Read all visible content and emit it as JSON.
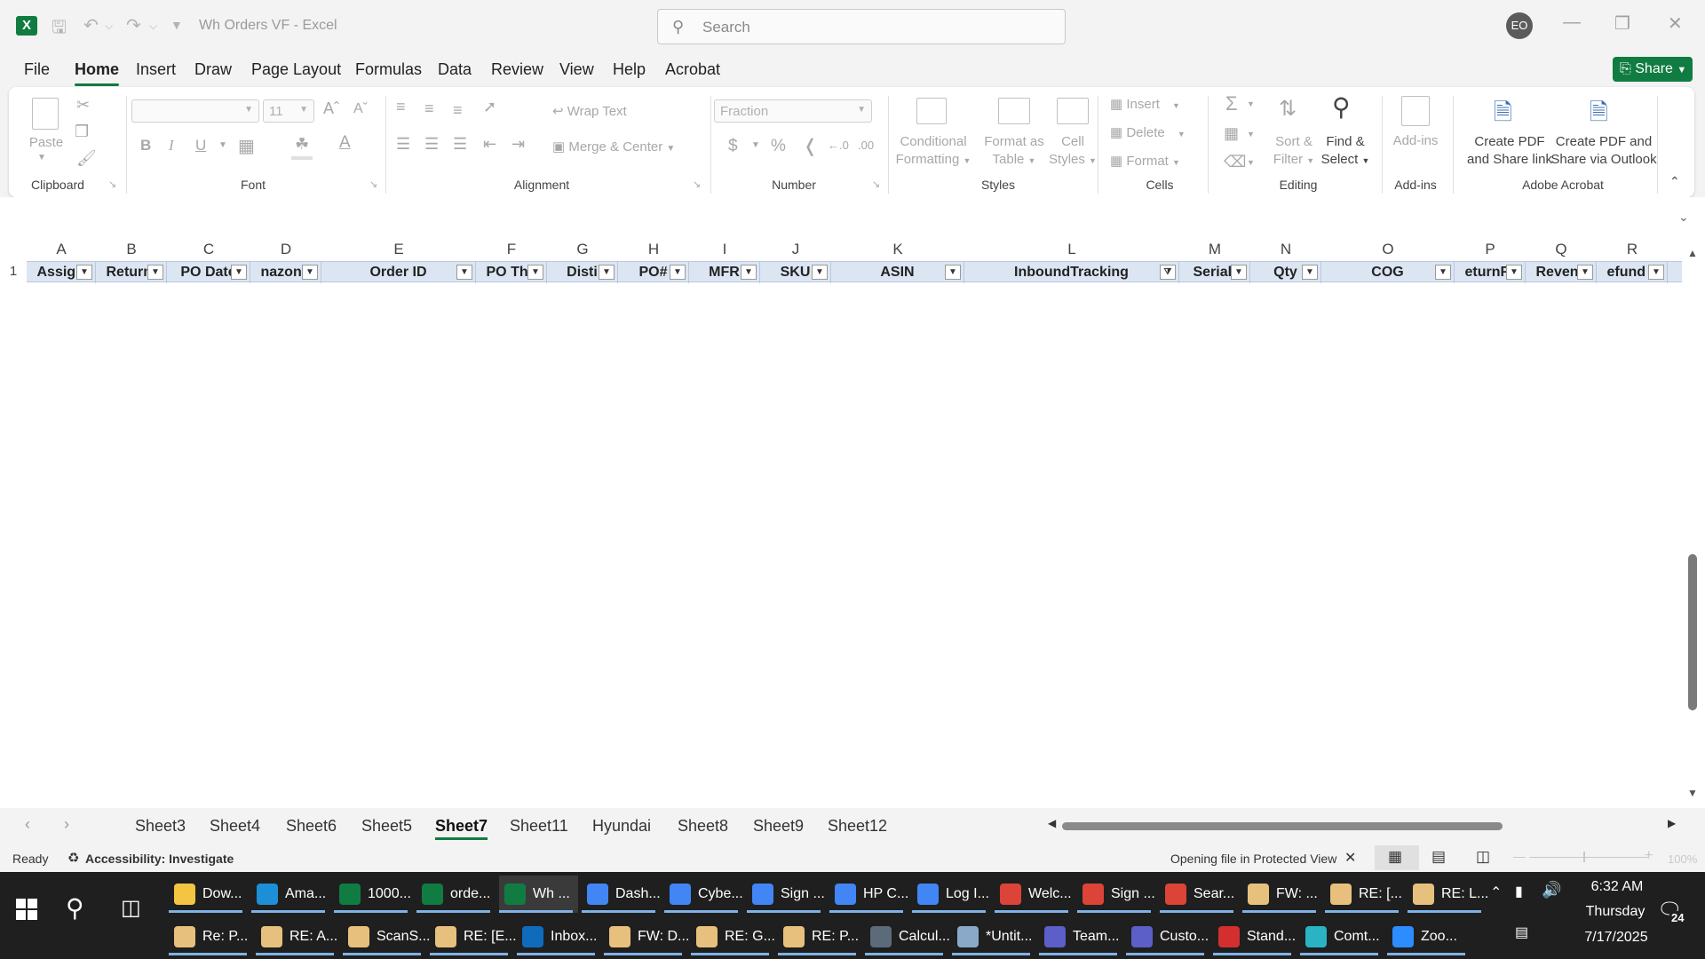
{
  "window": {
    "title": "Wh Orders VF  -  Excel",
    "search_placeholder": "Search",
    "avatar": "EO"
  },
  "menu": [
    "File",
    "Home",
    "Insert",
    "Draw",
    "Page Layout",
    "Formulas",
    "Data",
    "Review",
    "View",
    "Help",
    "Acrobat"
  ],
  "share_label": "Share",
  "ribbon": {
    "clipboard": {
      "label": "Clipboard",
      "paste": "Paste"
    },
    "font": {
      "label": "Font",
      "size": "11",
      "bold": "B",
      "italic": "I",
      "underline": "U"
    },
    "alignment": {
      "label": "Alignment",
      "wrap": "Wrap Text",
      "merge": "Merge & Center"
    },
    "number": {
      "label": "Number",
      "format": "Fraction"
    },
    "styles": {
      "label": "Styles",
      "conditional": [
        "Conditional",
        "Formatting"
      ],
      "format_table": [
        "Format as",
        "Table"
      ],
      "cell_styles": [
        "Cell",
        "Styles"
      ]
    },
    "cells": {
      "label": "Cells",
      "insert": "Insert",
      "delete": "Delete",
      "format": "Format"
    },
    "editing": {
      "label": "Editing",
      "sort": [
        "Sort &",
        "Filter"
      ],
      "find": [
        "Find &",
        "Select"
      ]
    },
    "addins": {
      "label": "Add-ins",
      "addins": "Add-ins"
    },
    "acrobat": {
      "label": "Adobe Acrobat",
      "pdf_link": [
        "Create PDF",
        "and Share link"
      ],
      "pdf_outlook": [
        "Create PDF and",
        "Share via Outlook"
      ]
    }
  },
  "columns": [
    {
      "letter": "A",
      "header": "Assigned"
    },
    {
      "letter": "B",
      "header": "Return D"
    },
    {
      "letter": "C",
      "header": "PO Date"
    },
    {
      "letter": "D",
      "header": "nazon Ac"
    },
    {
      "letter": "E",
      "header": "Order ID"
    },
    {
      "letter": "F",
      "header": "PO Throi"
    },
    {
      "letter": "G",
      "header": "Disti"
    },
    {
      "letter": "H",
      "header": "PO#"
    },
    {
      "letter": "I",
      "header": "MFR"
    },
    {
      "letter": "J",
      "header": "SKU"
    },
    {
      "letter": "K",
      "header": "ASIN"
    },
    {
      "letter": "L",
      "header": "InboundTracking"
    },
    {
      "letter": "M",
      "header": "Seriali"
    },
    {
      "letter": "N",
      "header": "Qty"
    },
    {
      "letter": "O",
      "header": "COG"
    },
    {
      "letter": "P",
      "header": "eturnFre"
    },
    {
      "letter": "Q",
      "header": "Revenu"
    },
    {
      "letter": "R",
      "header": "efund Is"
    }
  ],
  "row_number": "1",
  "sheets": [
    "Sheet3",
    "Sheet4",
    "Sheet6",
    "Sheet5",
    "Sheet7",
    "Sheet11",
    "Hyundai",
    "Sheet8",
    "Sheet9",
    "Sheet12"
  ],
  "active_sheet": "Sheet7",
  "status": {
    "ready": "Ready",
    "accessibility": "Accessibility: Investigate",
    "protected": "Opening file in Protected View",
    "zoom": "100%"
  },
  "taskbar_row1": [
    {
      "label": "Dow...",
      "icon": "folder-icon",
      "color": "#f4c542"
    },
    {
      "label": "Ama...",
      "icon": "edge-icon",
      "color": "#1c8fd6"
    },
    {
      "label": "1000...",
      "icon": "excel-icon",
      "color": "#107c41"
    },
    {
      "label": "orde...",
      "icon": "excel-icon",
      "color": "#107c41"
    },
    {
      "label": "Wh ...",
      "icon": "excel-icon",
      "color": "#107c41"
    },
    {
      "label": "Dash...",
      "icon": "chrome-icon",
      "color": "#4285f4"
    },
    {
      "label": "Cybe...",
      "icon": "chrome-icon",
      "color": "#4285f4"
    },
    {
      "label": "Sign ...",
      "icon": "chrome-icon",
      "color": "#4285f4"
    },
    {
      "label": "HP C...",
      "icon": "chrome-icon",
      "color": "#4285f4"
    },
    {
      "label": "Log I...",
      "icon": "chrome-icon",
      "color": "#4285f4"
    },
    {
      "label": "Welc...",
      "icon": "chrome-icon",
      "color": "#db4437"
    },
    {
      "label": "Sign ...",
      "icon": "chrome-icon",
      "color": "#db4437"
    },
    {
      "label": "Sear...",
      "icon": "chrome-icon",
      "color": "#db4437"
    },
    {
      "label": "FW: ...",
      "icon": "mail-icon",
      "color": "#e8c07d"
    },
    {
      "label": "RE: [...",
      "icon": "mail-icon",
      "color": "#e8c07d"
    },
    {
      "label": "RE: L...",
      "icon": "mail-icon",
      "color": "#e8c07d"
    }
  ],
  "taskbar_row2": [
    {
      "label": "Re: P...",
      "icon": "mail-icon",
      "color": "#e8c07d"
    },
    {
      "label": "RE: A...",
      "icon": "mail-icon",
      "color": "#e8c07d"
    },
    {
      "label": "ScanS...",
      "icon": "mail-icon",
      "color": "#e8c07d"
    },
    {
      "label": "RE: [E...",
      "icon": "mail-icon",
      "color": "#e8c07d"
    },
    {
      "label": "Inbox...",
      "icon": "outlook-icon",
      "color": "#0f6cbd"
    },
    {
      "label": "FW: D...",
      "icon": "mail-icon",
      "color": "#e8c07d"
    },
    {
      "label": "RE: G...",
      "icon": "mail-icon",
      "color": "#e8c07d"
    },
    {
      "label": "RE: P...",
      "icon": "mail-icon",
      "color": "#e8c07d"
    },
    {
      "label": "Calcul...",
      "icon": "calculator-icon",
      "color": "#5c6b7a"
    },
    {
      "label": "*Untit...",
      "icon": "notepad-icon",
      "color": "#8aa9c9"
    },
    {
      "label": "Team...",
      "icon": "teams-icon",
      "color": "#5b5fc7"
    },
    {
      "label": "Custo...",
      "icon": "teams-icon",
      "color": "#5b5fc7"
    },
    {
      "label": "Stand...",
      "icon": "pdf-icon",
      "color": "#d32f2f"
    },
    {
      "label": "Comt...",
      "icon": "app-icon",
      "color": "#2ab3c4"
    },
    {
      "label": "Zoo...",
      "icon": "zoom-icon",
      "color": "#2d8cff"
    }
  ],
  "clock": {
    "time": "6:32 AM",
    "day": "Thursday",
    "date": "7/17/2025"
  },
  "notifications": "24"
}
